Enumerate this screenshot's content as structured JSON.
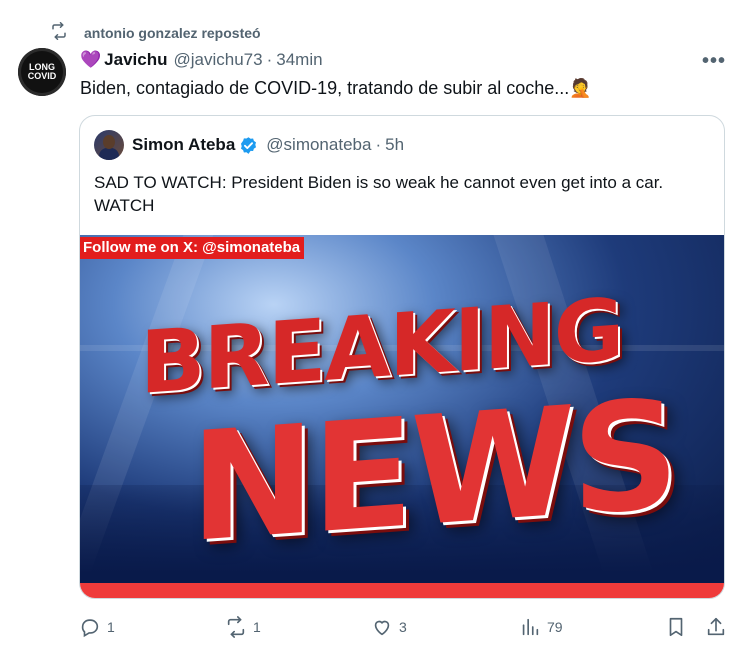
{
  "repost": {
    "label": "antonio gonzalez reposteó"
  },
  "post": {
    "avatar_text": "LONG COVID",
    "emoji": "💜",
    "display_name": "Javichu",
    "handle": "@javichu73",
    "time": "34min",
    "text": "Biden, contagiado de COVID-19, tratando de subir al coche...🤦"
  },
  "quote": {
    "display_name": "Simon Ateba",
    "handle": "@simonateba",
    "time": "5h",
    "text": "SAD TO WATCH: President Biden is so weak he cannot even get into a car. WATCH",
    "media": {
      "overlay_label": "Follow me on X: @simonateba",
      "headline_top": "BREAKING",
      "headline_bottom": "NEWS"
    }
  },
  "actions": {
    "replies": "1",
    "reposts": "1",
    "likes": "3",
    "views": "79"
  },
  "colors": {
    "muted": "#536471",
    "verified": "#1d9bf0",
    "accent_red": "#e21d1d"
  }
}
